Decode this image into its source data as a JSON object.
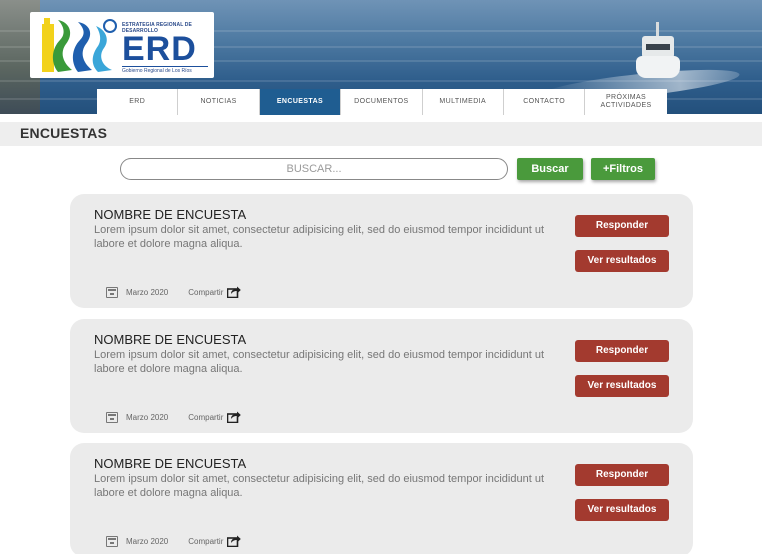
{
  "header": {
    "logo": {
      "tagline": "ESTRATEGIA REGIONAL DE DESARROLLO",
      "brand": "ERD",
      "subtitle": "Gobierno Regional de Los Ríos"
    }
  },
  "nav": {
    "items": [
      {
        "label": "ERD"
      },
      {
        "label": "NOTICIAS"
      },
      {
        "label": "ENCUESTAS"
      },
      {
        "label": "DOCUMENTOS"
      },
      {
        "label": "MULTIMEDIA"
      },
      {
        "label": "CONTACTO"
      },
      {
        "label": "PRÓXIMAS ACTIVIDADES"
      }
    ],
    "active_index": 2
  },
  "page": {
    "title": "ENCUESTAS"
  },
  "search": {
    "placeholder": "BUSCAR...",
    "search_button": "Buscar",
    "filters_button": "+Filtros"
  },
  "surveys": [
    {
      "name": "NOMBRE DE ENCUESTA",
      "description": "Lorem ipsum dolor sit amet, consectetur adipisicing elit, sed do eiusmod tempor incididunt ut labore et dolore magna aliqua.",
      "date": "Marzo 2020",
      "share_label": "Compartir",
      "respond_button": "Responder",
      "results_button": "Ver resultados"
    },
    {
      "name": "NOMBRE DE ENCUESTA",
      "description": "Lorem ipsum dolor sit amet, consectetur adipisicing elit, sed do eiusmod tempor incididunt ut labore et dolore magna aliqua.",
      "date": "Marzo 2020",
      "share_label": "Compartir",
      "respond_button": "Responder",
      "results_button": "Ver resultados"
    },
    {
      "name": "NOMBRE DE ENCUESTA",
      "description": "Lorem ipsum dolor sit amet, consectetur adipisicing elit, sed do eiusmod tempor incididunt ut labore et dolore magna aliqua.",
      "date": "Marzo 2020",
      "share_label": "Compartir",
      "respond_button": "Responder",
      "results_button": "Ver resultados"
    }
  ],
  "colors": {
    "nav_active": "#1f5d91",
    "button_green": "#4a9a3c",
    "button_red": "#a33a2f",
    "card_bg": "#ebebeb",
    "logo_blue": "#1c4f9c"
  },
  "icons": {
    "date": "calendar-icon",
    "share": "share-arrow-icon"
  }
}
